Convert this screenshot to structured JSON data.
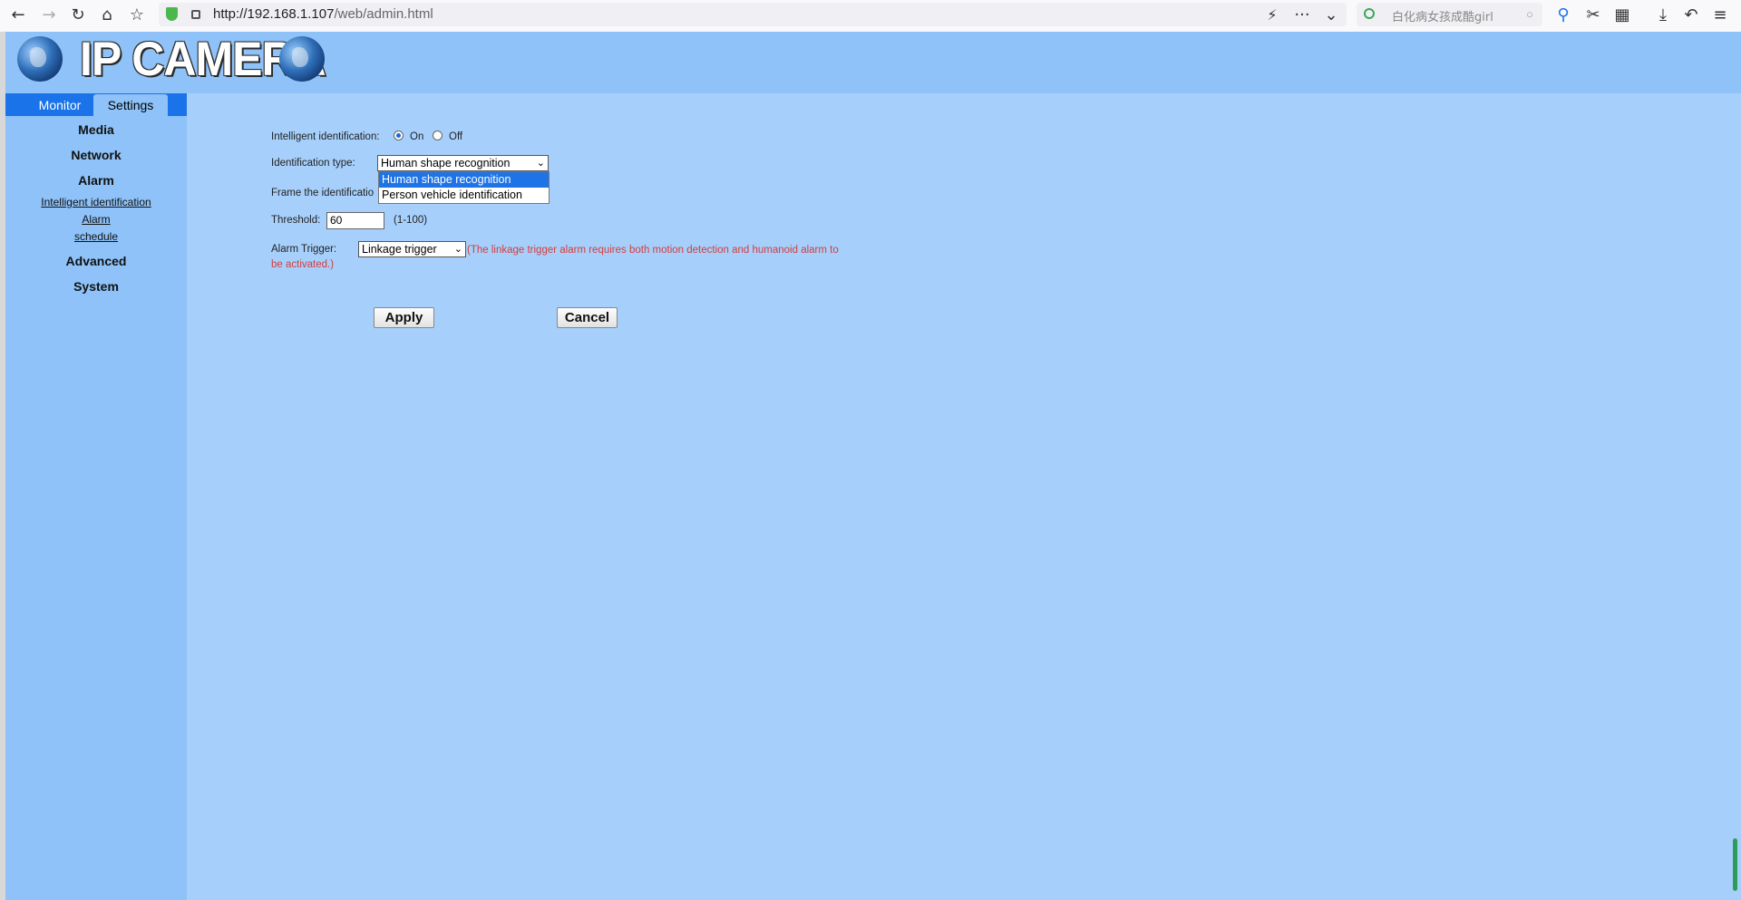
{
  "browser": {
    "back": "←",
    "forward": "→",
    "reload": "↻",
    "home": "⌂",
    "bookmark": "☆",
    "url_host": "http://192.168.1.107",
    "url_path": "/web/admin.html",
    "search_placeholder": "白化病女孩成酷girl",
    "more": "···",
    "expand": "⌄"
  },
  "header": {
    "logo": "IP CAMERA"
  },
  "tabs": {
    "monitor": "Monitor",
    "settings": "Settings"
  },
  "sidebar": {
    "media": "Media",
    "network": "Network",
    "alarm": "Alarm",
    "sub_intelligent": "Intelligent identification",
    "sub_alarm": "Alarm",
    "sub_schedule": "schedule",
    "advanced": "Advanced",
    "system": "System"
  },
  "form": {
    "intelligent_label": "Intelligent identification:",
    "on_label": "On",
    "off_label": "Off",
    "intelligent_value": "On",
    "type_label": "Identification type:",
    "type_selected": "Human shape recognition",
    "type_options": [
      "Human shape recognition",
      "Person vehicle identification"
    ],
    "frame_label": "Frame the identificatio",
    "threshold_label": "Threshold:",
    "threshold_value": "60",
    "threshold_range": "(1-100)",
    "trigger_label": "Alarm Trigger:",
    "trigger_selected": "Linkage trigger",
    "trigger_note": "(The linkage trigger alarm requires both motion detection and humanoid alarm to be activated.)",
    "apply": "Apply",
    "cancel": "Cancel"
  },
  "colors": {
    "page_bg": "#a6d0fb",
    "sidebar_bg": "#8ec2f8",
    "tab_bar": "#1a73e8",
    "note_red": "#d43c3c",
    "selected_option": "#1e73e6"
  }
}
